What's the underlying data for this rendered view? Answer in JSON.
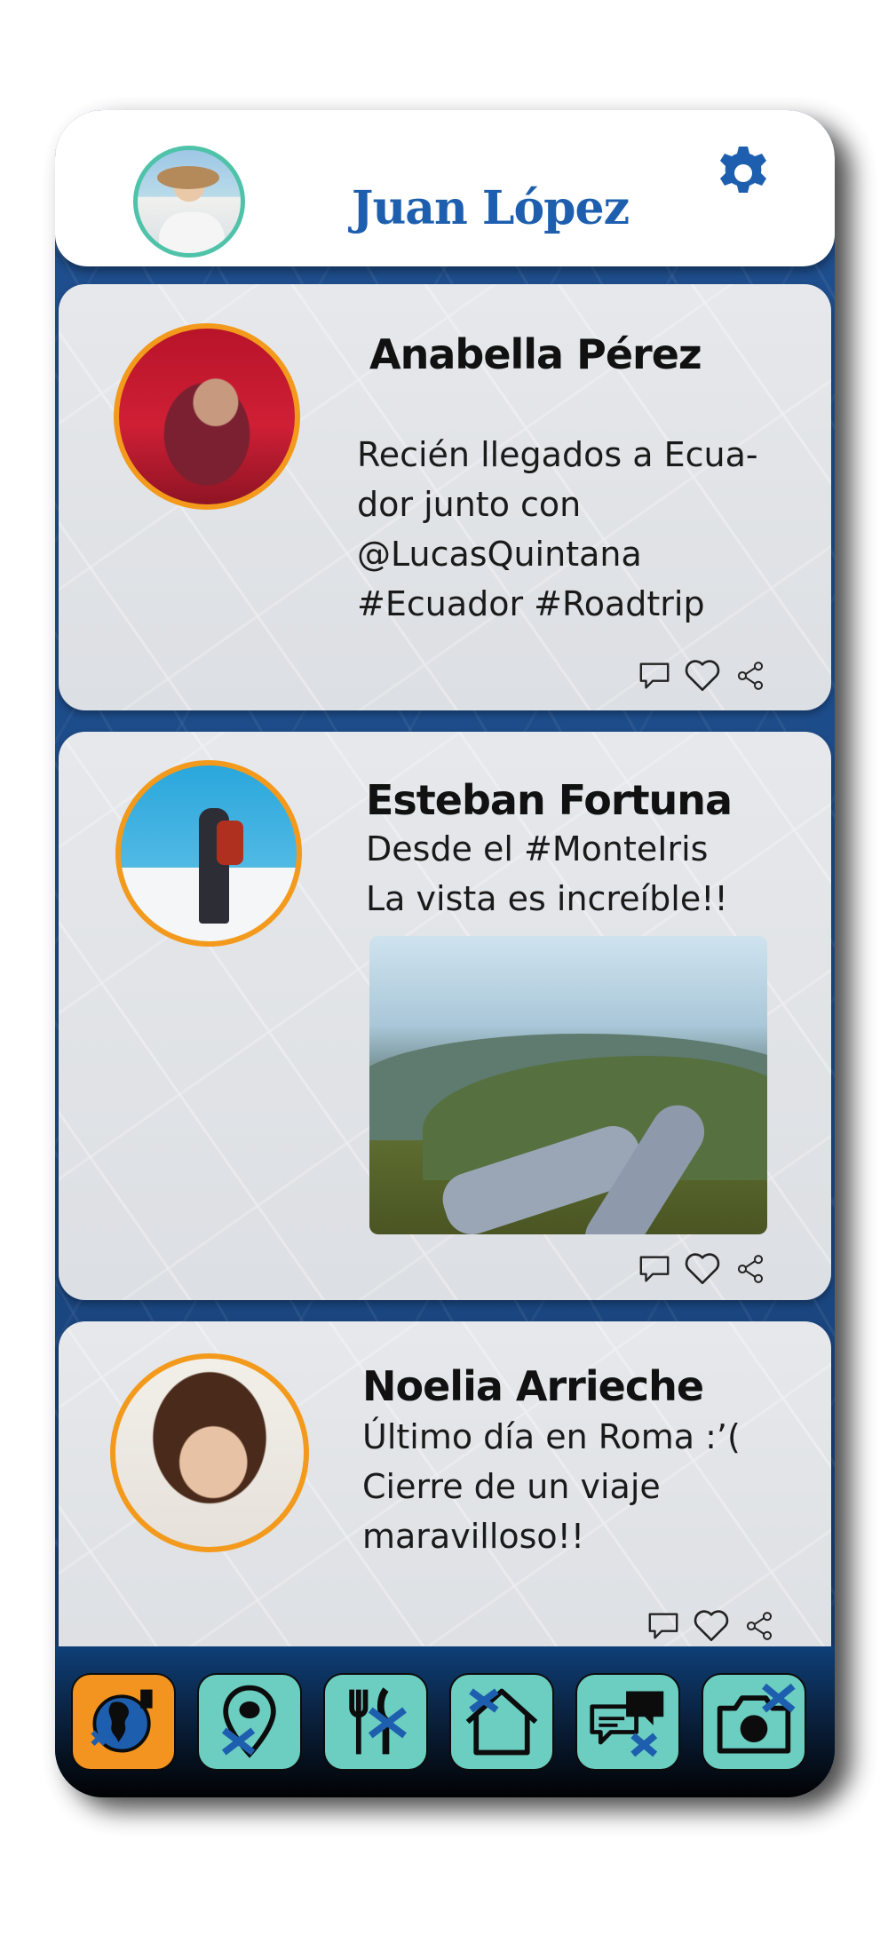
{
  "app": {
    "user_name": "Juan López",
    "accent_color": "#1d5fae",
    "avatar_ring_color": "#f39a1d",
    "header_avatar_ring_color": "#4fc3a9"
  },
  "header": {
    "settings_icon": "gear-icon"
  },
  "posts": [
    {
      "author": "Anabella Pérez",
      "text": "Recién llegados a Ecua-\ndor junto con\n@LucasQuintana\n#Ecuador #Roadtrip",
      "has_image": false
    },
    {
      "author": "Esteban Fortuna",
      "text": "Desde el #MonteIris\nLa vista es increíble!!",
      "has_image": true
    },
    {
      "author": "Noelia Arrieche",
      "text": "Último día en Roma :’(\nCierre de un viaje\nmaravilloso!!",
      "has_image": false
    }
  ],
  "post_actions": [
    "comment-icon",
    "heart-icon",
    "share-icon"
  ],
  "bottom_nav": {
    "items": [
      {
        "icon": "map-globe-icon",
        "active": true
      },
      {
        "icon": "location-pin-icon",
        "active": false
      },
      {
        "icon": "restaurant-icon",
        "active": false
      },
      {
        "icon": "home-icon",
        "active": false
      },
      {
        "icon": "chat-icon",
        "active": false
      },
      {
        "icon": "camera-icon",
        "active": false
      }
    ],
    "active_color": "#f2941f",
    "inactive_color": "#6ccdc1"
  }
}
